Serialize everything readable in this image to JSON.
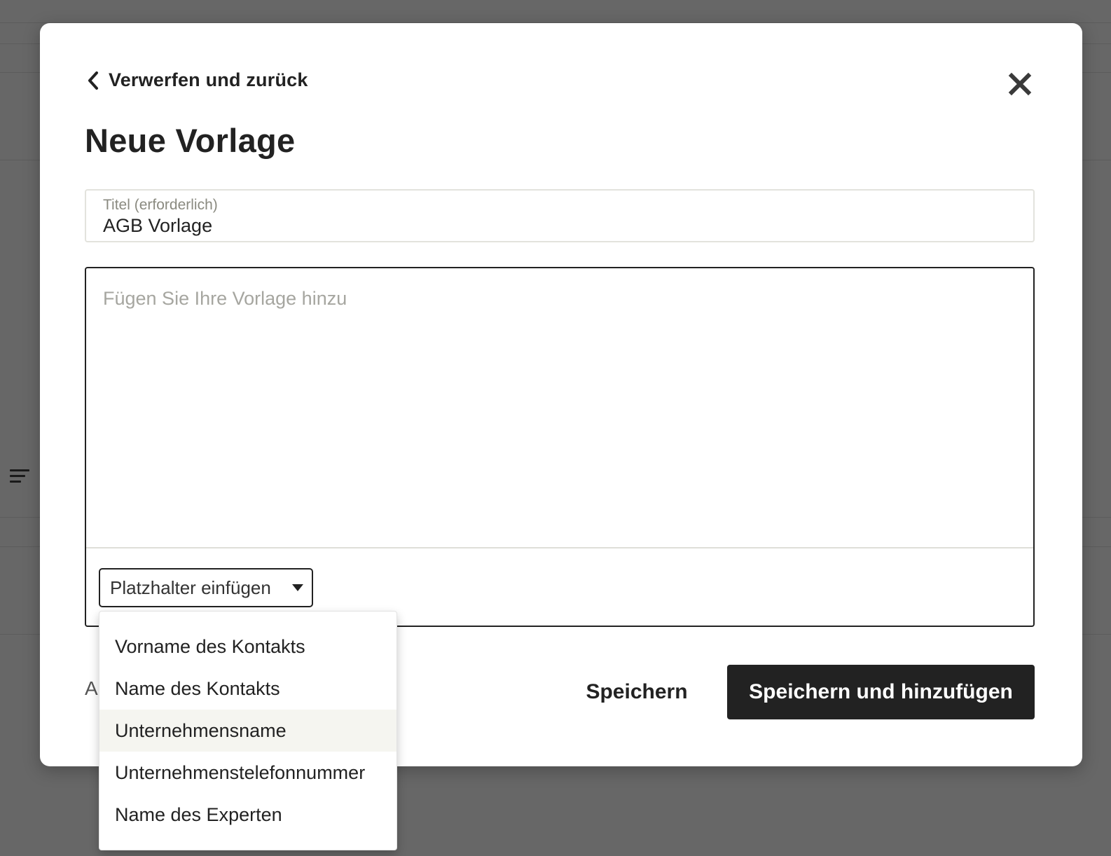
{
  "modal": {
    "back_label": "Verwerfen und zurück",
    "title": "Neue Vorlage",
    "title_field": {
      "label": "Titel (erforderlich)",
      "value": "AGB Vorlage"
    },
    "editor": {
      "placeholder": "Fügen Sie Ihre Vorlage hinzu",
      "value": ""
    },
    "placeholder_select": {
      "label": "Platzhalter einfügen",
      "options": [
        "Vorname des Kontakts",
        "Name des Kontakts",
        "Unternehmensname",
        "Unternehmenstelefonnummer",
        "Name des Experten"
      ],
      "highlighted_option": "Unternehmensname"
    },
    "footer": {
      "hint_visible": "A",
      "save_label": "Speichern",
      "save_add_label": "Speichern und hinzufügen"
    }
  },
  "icons": {
    "back": "chevron-left-icon",
    "close": "close-icon",
    "dropdown": "caret-down-icon",
    "background_menu": "menu-lines-icon"
  },
  "colors": {
    "backdrop": "#676767",
    "primary_button": "#222222",
    "highlight_row": "#f5f5f0"
  }
}
